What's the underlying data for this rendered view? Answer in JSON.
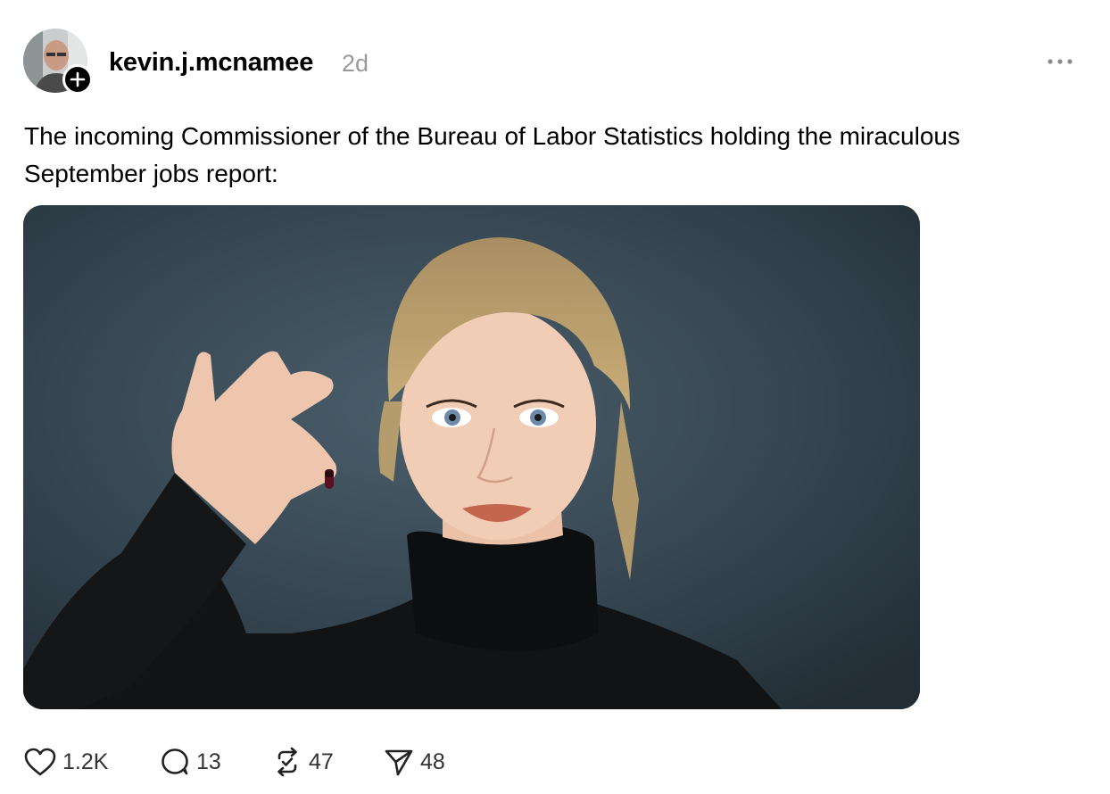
{
  "post": {
    "username": "kevin.j.mcnamee",
    "timestamp": "2d",
    "text": "The incoming Commissioner of the Bureau of Labor Statistics holding the miraculous September jobs report:",
    "image_alt": "Photo of a woman in a black turtleneck holding up a small pill between two fingers"
  },
  "actions": {
    "likes": "1.2K",
    "replies": "13",
    "reposts": "47",
    "shares": "48"
  },
  "icons": {
    "more": "more-horizontal-icon",
    "follow": "plus-icon",
    "like": "heart-icon",
    "reply": "comment-bubble-icon",
    "repost": "repost-icon",
    "share": "send-icon"
  },
  "colors": {
    "text": "#000000",
    "muted": "#9a9a9a",
    "count": "#333333"
  }
}
